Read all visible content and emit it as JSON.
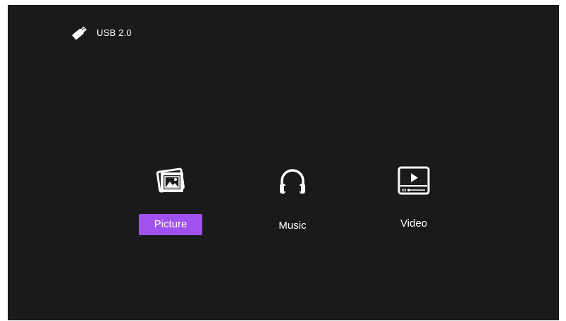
{
  "source": {
    "icon": "usb-drive-icon",
    "label": "USB 2.0"
  },
  "menu": {
    "selected": "picture",
    "accent_color": "#a052ee",
    "items": [
      {
        "id": "picture",
        "icon": "picture-icon",
        "label": "Picture"
      },
      {
        "id": "music",
        "icon": "headphones-icon",
        "label": "Music"
      },
      {
        "id": "video",
        "icon": "video-player-icon",
        "label": "Video"
      }
    ]
  }
}
